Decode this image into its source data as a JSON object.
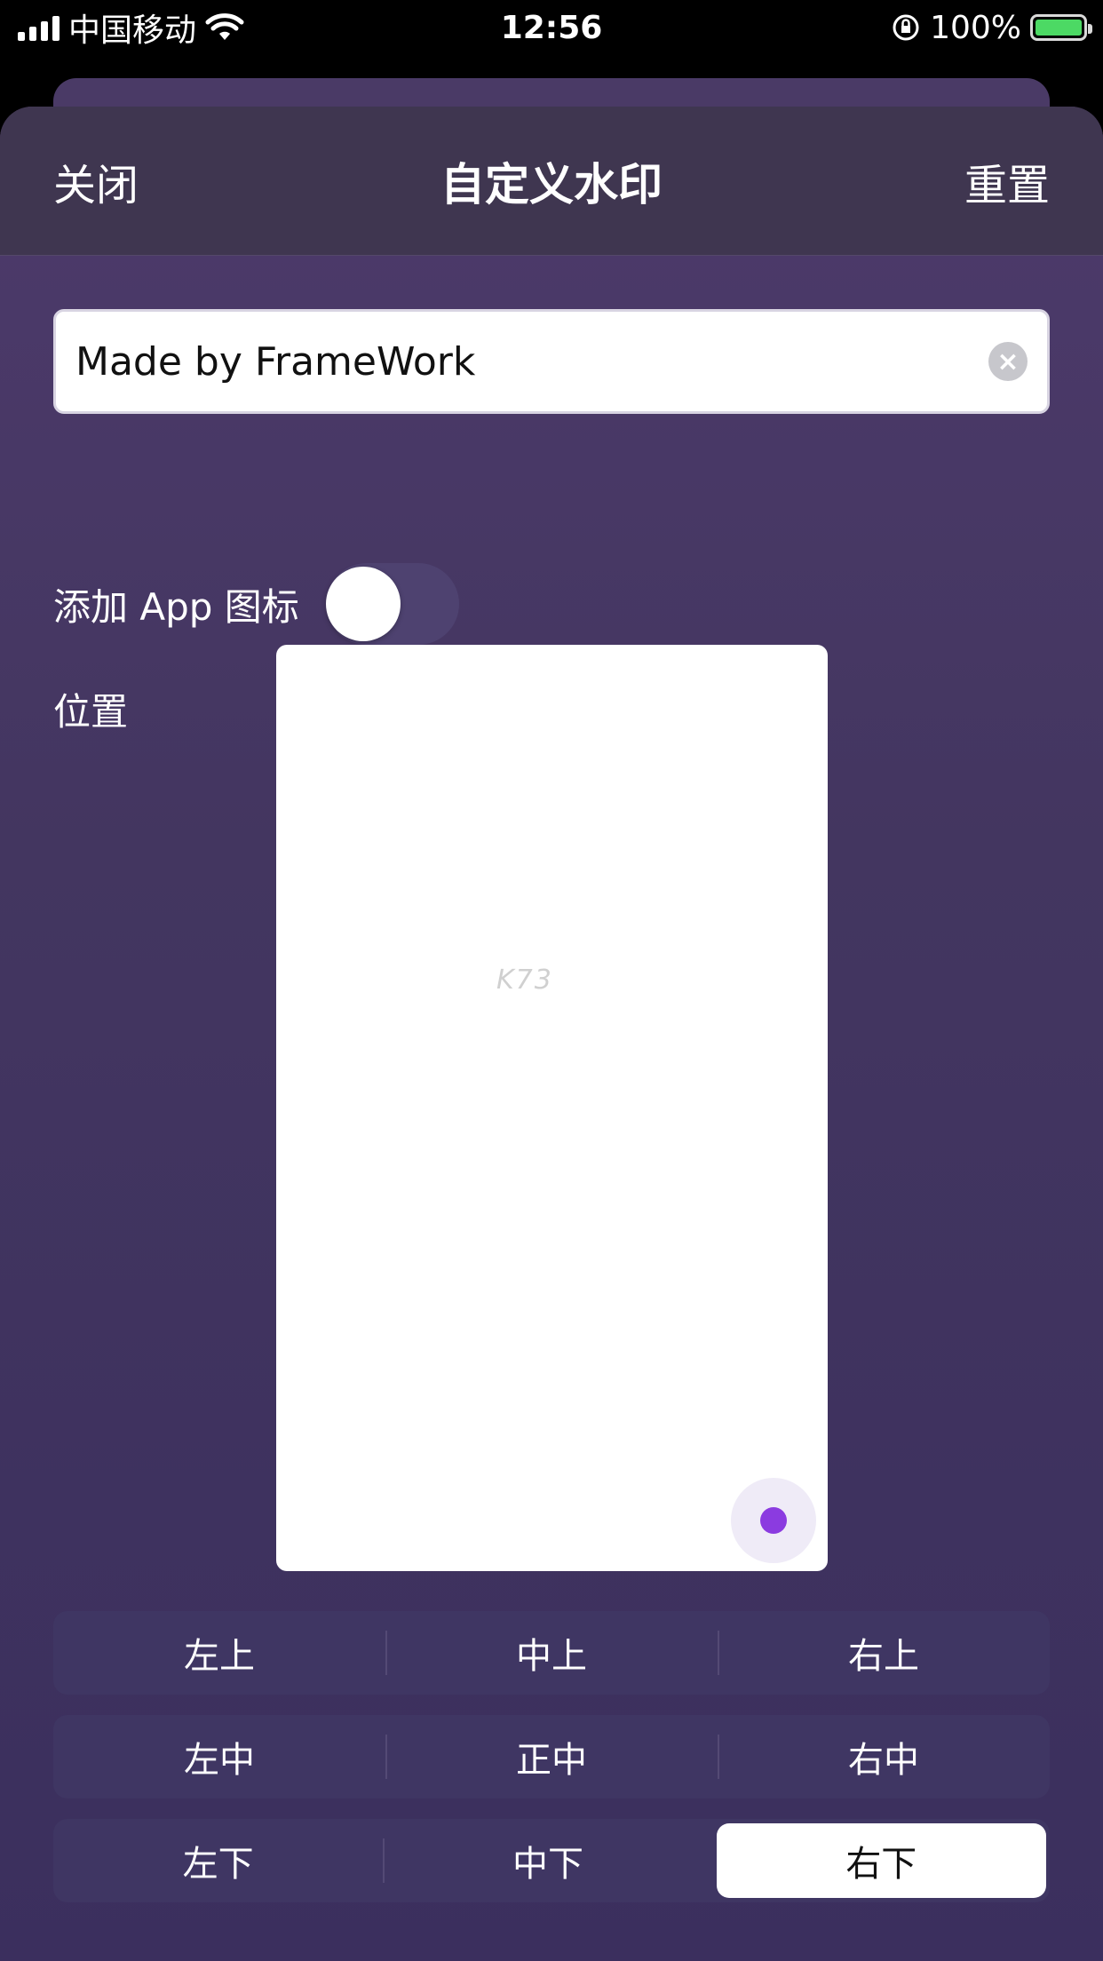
{
  "status_bar": {
    "carrier": "中国移动",
    "time": "12:56",
    "battery": "100%",
    "battery_level": 1.0
  },
  "nav": {
    "close": "关闭",
    "title": "自定义水印",
    "reset": "重置"
  },
  "watermark_field": {
    "value": "Made by FrameWork"
  },
  "app_icon_toggle": {
    "label": "添加 App 图标",
    "on": false
  },
  "position": {
    "label": "位置",
    "preview_watermark": "K73",
    "options": [
      [
        "左上",
        "中上",
        "右上"
      ],
      [
        "左中",
        "正中",
        "右中"
      ],
      [
        "左下",
        "中下",
        "右下"
      ]
    ],
    "selected": "右下"
  },
  "colors": {
    "accent_dot": "#8b3be0",
    "battery_green": "#4cd964"
  }
}
